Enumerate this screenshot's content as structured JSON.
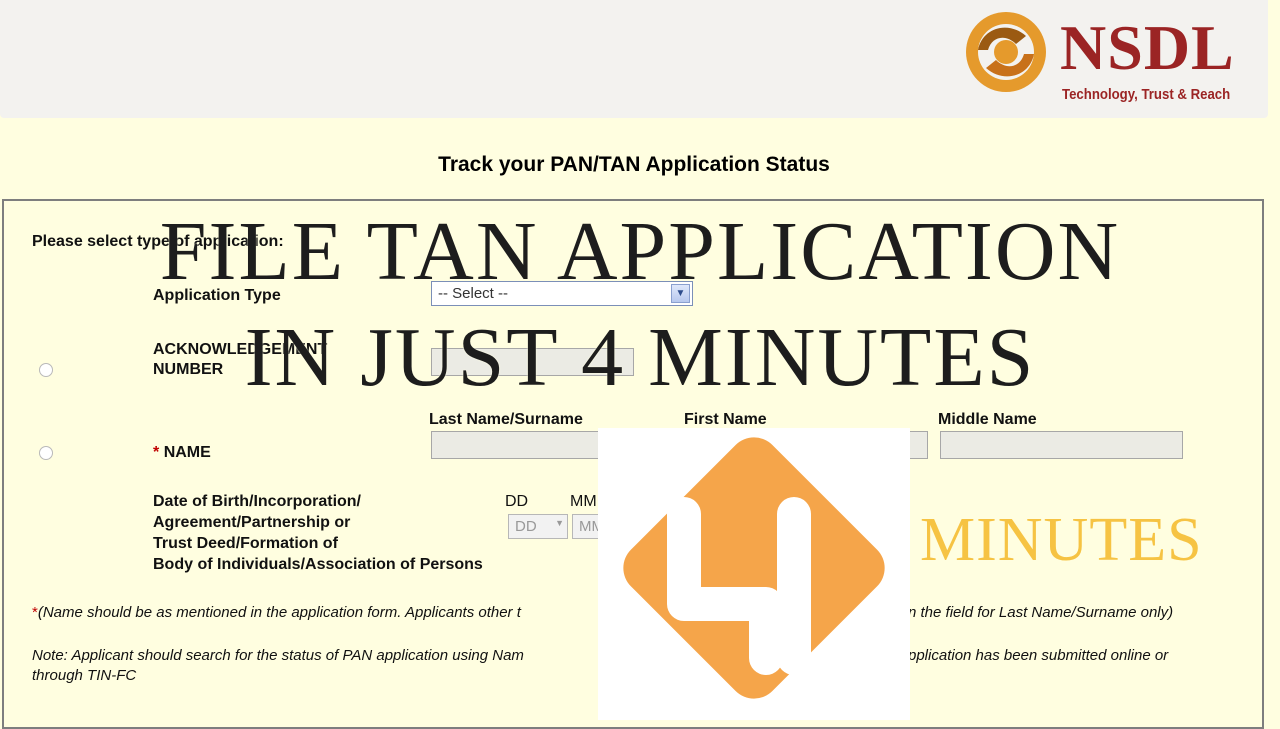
{
  "logo": {
    "name": "NSDL",
    "tagline": "Technology, Trust & Reach"
  },
  "page": {
    "heading": "Track your PAN/TAN Application Status"
  },
  "form": {
    "select_type_label": "Please select type of application:",
    "application_type_label": "Application Type",
    "application_type_value": "-- Select --",
    "ack_label_line1": "ACKNOWLEDGEMENT",
    "ack_label_line2": "NUMBER",
    "name_required_mark": "*",
    "name_label": "NAME",
    "last_name_header": "Last Name/Surname",
    "first_name_header": "First Name",
    "middle_name_header": "Middle Name",
    "dob_label_lines": [
      "Date of Birth/Incorporation/",
      "Agreement/Partnership or",
      "Trust Deed/Formation of",
      "Body of Individuals/Association of Persons"
    ],
    "dd_header": "DD",
    "mm_header": "MM",
    "dd_placeholder": "DD",
    "mm_placeholder": "MM",
    "note1_mark": "*",
    "note1_left": "(Name should be as mentioned in the application form. Applicants other t",
    "note1_right": "n the field for Last Name/Surname only)",
    "note2_left": "Note: Applicant should search for the status of PAN application using Nam",
    "note2_right": "pplication has been submitted online or",
    "note2_line2": "through TIN-FC"
  },
  "overlay": {
    "line1": "FILE TAN APPLICATION",
    "line2": "IN JUST 4 MINUTES",
    "badge_digit": "4",
    "minutes_text": "MINUTES"
  },
  "colors": {
    "brand": "#9b2424",
    "badge": "#f5a54a",
    "minutes": "#f6c343",
    "page_bg": "#fffee0"
  }
}
